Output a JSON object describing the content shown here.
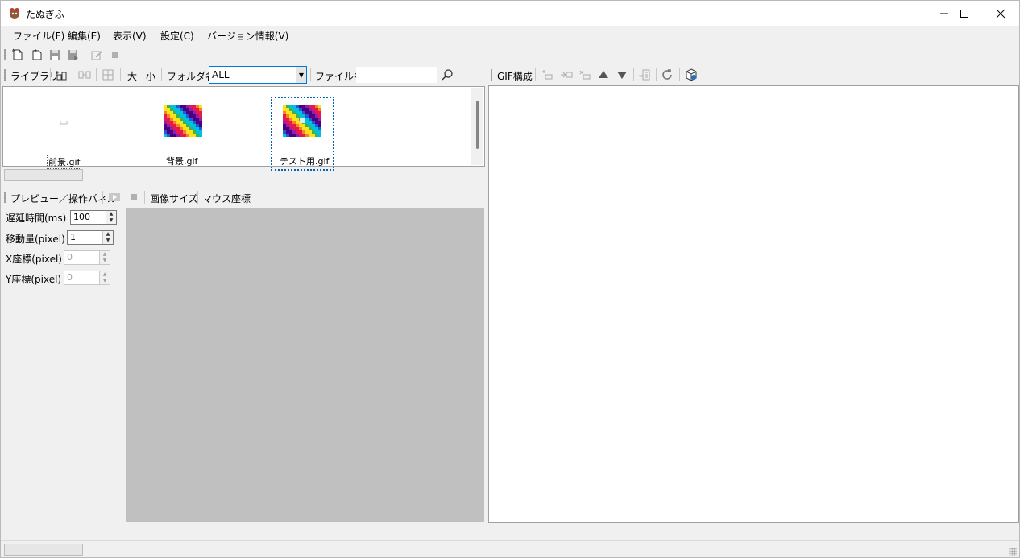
{
  "window": {
    "title": "たぬぎふ",
    "app_icon": "tanuki-app-icon"
  },
  "menu": [
    "ファイル(F)",
    "編集(E)",
    "表示(V)",
    "設定(C)",
    "バージョン情報(V)"
  ],
  "library_bar": {
    "label": "ライブラリ",
    "size_large": "大",
    "size_small": "小",
    "folder_label": "フォルダ名",
    "folder_value": "ALL",
    "filename_label": "ファイル名",
    "filename_value": ""
  },
  "library_items": [
    {
      "name": "前景.gif",
      "thumbnail": "broken"
    },
    {
      "name": "背景.gif",
      "thumbnail": "rainbow-diagonal"
    },
    {
      "name": "テスト用.gif",
      "thumbnail": "rainbow-diagonal-with-sprite",
      "selected": true
    }
  ],
  "preview_bar": {
    "label": "プレビュー／操作パネル",
    "image_size_label": "画像サイズ",
    "mouse_coord_label": "マウス座標"
  },
  "params": [
    {
      "label": "遅延時間(ms)",
      "value": "100",
      "enabled": true
    },
    {
      "label": "移動量(pixel)",
      "value": "1",
      "enabled": true
    },
    {
      "label": "X座標(pixel)",
      "value": "0",
      "enabled": false
    },
    {
      "label": "Y座標(pixel)",
      "value": "0",
      "enabled": false
    }
  ],
  "gif_bar": {
    "label": "GIF構成"
  },
  "colors": {
    "accent": "#0078d7",
    "preview_bg": "#c0c0c0",
    "chrome": "#f0f0f0"
  }
}
